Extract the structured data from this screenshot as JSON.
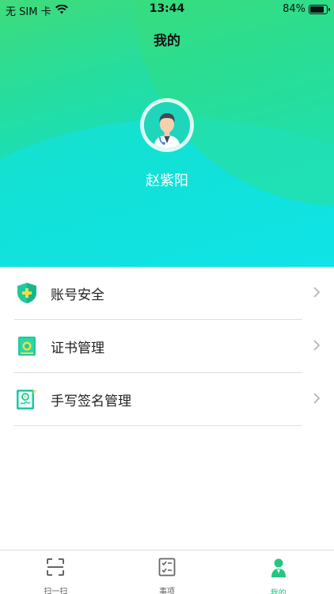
{
  "status_bar": {
    "carrier": "无 SIM 卡",
    "time": "13:44",
    "battery": "84%"
  },
  "header": {
    "title": "我的"
  },
  "profile": {
    "name": "赵紫阳"
  },
  "menu": {
    "items": [
      {
        "label": "账号安全",
        "icon": "shield-plus-icon"
      },
      {
        "label": "证书管理",
        "icon": "certificate-icon"
      },
      {
        "label": "手写签名管理",
        "icon": "signature-tablet-icon"
      }
    ]
  },
  "tabbar": {
    "items": [
      {
        "label": "扫一扫",
        "icon": "scan-icon",
        "active": false
      },
      {
        "label": "事项",
        "icon": "checklist-icon",
        "active": false
      },
      {
        "label": "我的",
        "icon": "person-icon",
        "active": true
      }
    ]
  },
  "colors": {
    "accent": "#22c780",
    "gradient_top": "#3fdc7a",
    "gradient_bottom": "#10e6e6"
  }
}
